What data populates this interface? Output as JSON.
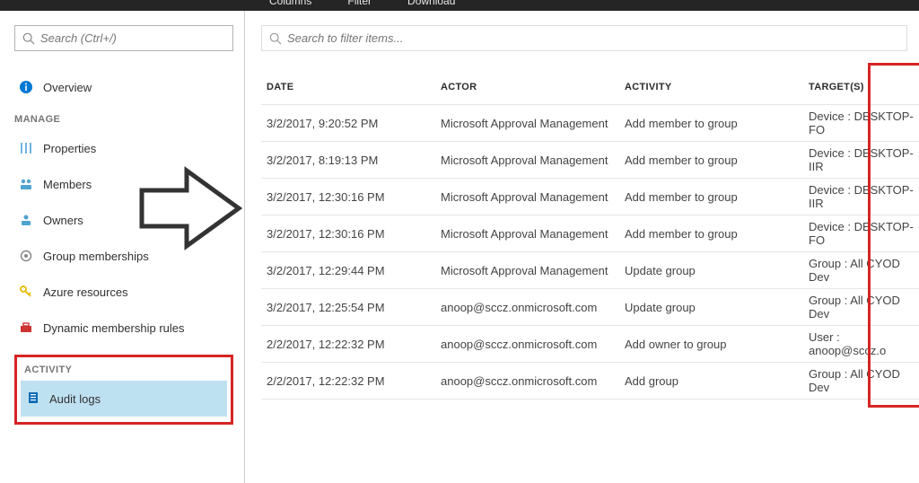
{
  "topbar": {
    "columns": "Columns",
    "filter": "Filter",
    "download": "Download"
  },
  "sidebar": {
    "search_placeholder": "Search (Ctrl+/)",
    "overview": "Overview",
    "manage_label": "MANAGE",
    "items": [
      {
        "label": "Properties"
      },
      {
        "label": "Members"
      },
      {
        "label": "Owners"
      },
      {
        "label": "Group memberships"
      },
      {
        "label": "Azure resources"
      },
      {
        "label": "Dynamic membership rules"
      }
    ],
    "activity_label": "ACTIVITY",
    "audit_logs": "Audit logs"
  },
  "main": {
    "filter_placeholder": "Search to filter items...",
    "headers": {
      "date": "DATE",
      "actor": "ACTOR",
      "activity": "ACTIVITY",
      "target": "TARGET(S)"
    },
    "rows": [
      {
        "date": "3/2/2017, 9:20:52 PM",
        "actor": "Microsoft Approval Management",
        "activity": "Add member to group",
        "target": "Device : DESKTOP-FO"
      },
      {
        "date": "3/2/2017, 8:19:13 PM",
        "actor": "Microsoft Approval Management",
        "activity": "Add member to group",
        "target": "Device : DESKTOP-IIR"
      },
      {
        "date": "3/2/2017, 12:30:16 PM",
        "actor": "Microsoft Approval Management",
        "activity": "Add member to group",
        "target": "Device : DESKTOP-IIR"
      },
      {
        "date": "3/2/2017, 12:30:16 PM",
        "actor": "Microsoft Approval Management",
        "activity": "Add member to group",
        "target": "Device : DESKTOP-FO"
      },
      {
        "date": "3/2/2017, 12:29:44 PM",
        "actor": "Microsoft Approval Management",
        "activity": "Update group",
        "target": "Group : All CYOD Dev"
      },
      {
        "date": "3/2/2017, 12:25:54 PM",
        "actor": "anoop@sccz.onmicrosoft.com",
        "activity": "Update group",
        "target": "Group : All CYOD Dev"
      },
      {
        "date": "2/2/2017, 12:22:32 PM",
        "actor": "anoop@sccz.onmicrosoft.com",
        "activity": "Add owner to group",
        "target": "User : anoop@sccz.o"
      },
      {
        "date": "2/2/2017, 12:22:32 PM",
        "actor": "anoop@sccz.onmicrosoft.com",
        "activity": "Add group",
        "target": "Group : All CYOD Dev"
      }
    ]
  }
}
